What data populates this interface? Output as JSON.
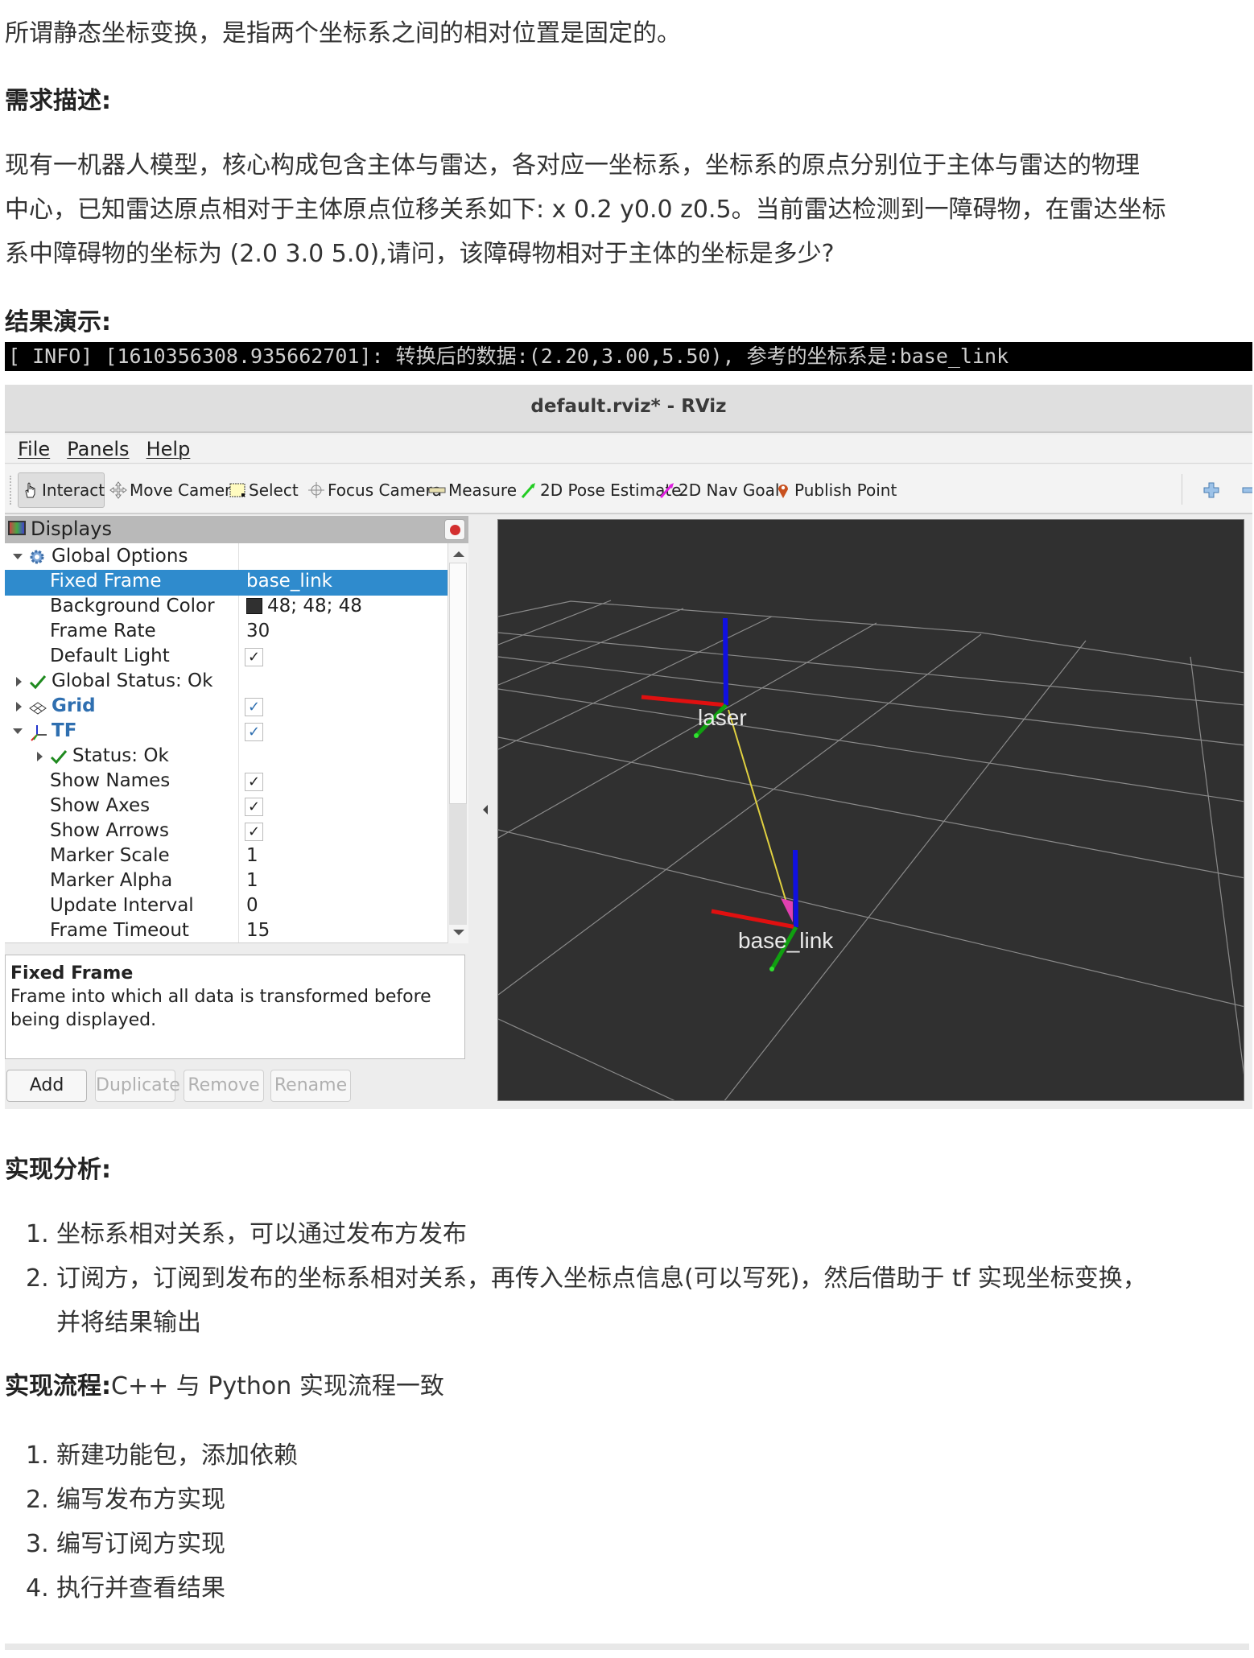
{
  "intro": "所谓静态坐标变换，是指两个坐标系之间的相对位置是固定的。",
  "requirement": {
    "heading": "需求描述:",
    "lines": [
      "现有一机器人模型，核心构成包含主体与雷达，各对应一坐标系，坐标系的原点分别位于主体与雷达的物理",
      "中心，已知雷达原点相对于主体原点位移关系如下: x 0.2 y0.0 z0.5。当前雷达检测到一障碍物，在雷达坐标",
      "系中障碍物的坐标为 (2.0 3.0 5.0),请问，该障碍物相对于主体的坐标是多少?"
    ]
  },
  "result": {
    "heading": "结果演示:",
    "terminal_line": "[ INFO] [1610356308.935662701]: 转换后的数据:(2.20,3.00,5.50), 参考的坐标系是:base_link"
  },
  "rviz": {
    "window_title": "default.rviz* - RViz",
    "menu": [
      "File",
      "Panels",
      "Help"
    ],
    "toolbar": [
      {
        "label": "Interact",
        "icon": "hand-pointer-icon",
        "active": true
      },
      {
        "label": "Move Camera",
        "icon": "move-camera-icon",
        "active": false
      },
      {
        "label": "Select",
        "icon": "select-box-icon",
        "active": false
      },
      {
        "label": "Focus Camera",
        "icon": "focus-camera-icon",
        "active": false
      },
      {
        "label": "Measure",
        "icon": "ruler-icon",
        "active": false
      },
      {
        "label": "2D Pose Estimate",
        "icon": "green-arrow-icon",
        "active": false
      },
      {
        "label": "2D Nav Goal",
        "icon": "magenta-arrow-icon",
        "active": false
      },
      {
        "label": "Publish Point",
        "icon": "map-pin-icon",
        "active": false
      }
    ],
    "displays": {
      "title": "Displays",
      "rows": [
        {
          "name": "Global Options",
          "value": "",
          "level": 0,
          "expand": "down",
          "icon": "gear-icon"
        },
        {
          "name": "Fixed Frame",
          "value": "base_link",
          "level": 1,
          "selected": true
        },
        {
          "name": "Background Color",
          "value": "48; 48; 48",
          "level": 1,
          "swatch": "#303030"
        },
        {
          "name": "Frame Rate",
          "value": "30",
          "level": 1
        },
        {
          "name": "Default Light",
          "value": "",
          "level": 1,
          "checkbox": true
        },
        {
          "name": "Global Status: Ok",
          "value": "",
          "level": 0,
          "expand": "right",
          "icon": "check-icon"
        },
        {
          "name": "Grid",
          "value": "",
          "level": 0,
          "expand": "right",
          "icon": "grid-icon",
          "blue": true,
          "checkbox": true
        },
        {
          "name": "TF",
          "value": "",
          "level": 0,
          "expand": "down",
          "icon": "tf-axes-icon",
          "blue": true,
          "checkbox": true
        },
        {
          "name": "Status: Ok",
          "value": "",
          "level": 1,
          "expand": "right",
          "icon": "check-icon"
        },
        {
          "name": "Show Names",
          "value": "",
          "level": 1,
          "checkbox": true
        },
        {
          "name": "Show Axes",
          "value": "",
          "level": 1,
          "checkbox": true
        },
        {
          "name": "Show Arrows",
          "value": "",
          "level": 1,
          "checkbox": true
        },
        {
          "name": "Marker Scale",
          "value": "1",
          "level": 1
        },
        {
          "name": "Marker Alpha",
          "value": "1",
          "level": 1
        },
        {
          "name": "Update Interval",
          "value": "0",
          "level": 1
        },
        {
          "name": "Frame Timeout",
          "value": "15",
          "level": 1
        }
      ],
      "description_title": "Fixed Frame",
      "description_text": "Frame into which all data is transformed before being displayed.",
      "buttons": [
        {
          "label": "Add",
          "enabled": true
        },
        {
          "label": "Duplicate",
          "enabled": false
        },
        {
          "label": "Remove",
          "enabled": false
        },
        {
          "label": "Rename",
          "enabled": false
        }
      ]
    },
    "viewport": {
      "background": "#303030",
      "frames": [
        {
          "name": "laser"
        },
        {
          "name": "base_link"
        }
      ]
    }
  },
  "analysis": {
    "heading": "实现分析:",
    "items": [
      "坐标系相对关系，可以通过发布方发布",
      "订阅方，订阅到发布的坐标系相对关系，再传入坐标点信息(可以写死)，然后借助于 tf 实现坐标变换，",
      "并将结果输出"
    ]
  },
  "flow": {
    "heading": "实现流程:",
    "heading_rest": "C++ 与 Python 实现流程一致",
    "items": [
      "新建功能包，添加依赖",
      "编写发布方实现",
      "编写订阅方实现",
      "执行并查看结果"
    ]
  }
}
